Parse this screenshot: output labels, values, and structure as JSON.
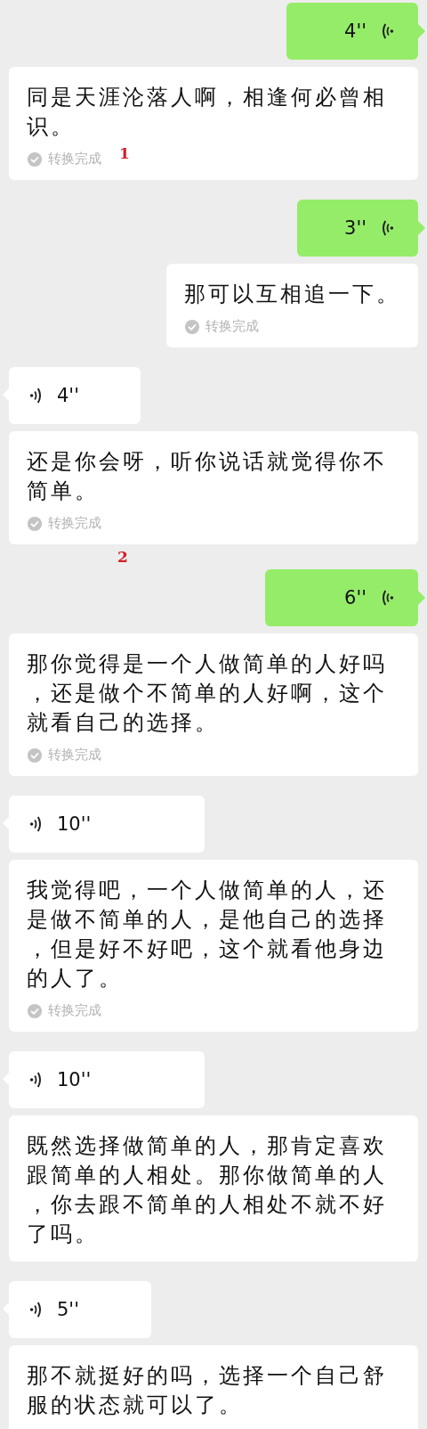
{
  "messages": [
    {
      "kind": "voice",
      "outgoing": true,
      "duration": "4''"
    },
    {
      "kind": "transcript",
      "outgoing": false,
      "lines": [
        "同是天涯沦落人啊，相逢何必曾相",
        "识。"
      ],
      "status": "转换完成",
      "marker": "1"
    },
    {
      "kind": "voice",
      "outgoing": true,
      "duration": "3''"
    },
    {
      "kind": "transcript",
      "outgoing": true,
      "lines": [
        "那可以互相追一下。"
      ],
      "status": "转换完成"
    },
    {
      "kind": "voice",
      "outgoing": false,
      "duration": "4''"
    },
    {
      "kind": "transcript",
      "outgoing": false,
      "lines": [
        "还是你会呀，听你说话就觉得你不",
        "简单。"
      ],
      "status": "转换完成"
    },
    {
      "kind": "marker",
      "text": "2"
    },
    {
      "kind": "voice",
      "outgoing": true,
      "duration": "6''"
    },
    {
      "kind": "transcript",
      "outgoing": false,
      "lines": [
        "那你觉得是一个人做简单的人好吗",
        "，还是做个不简单的人好啊，这个",
        "就看自己的选择。"
      ],
      "status": "转换完成"
    },
    {
      "kind": "voice",
      "outgoing": false,
      "duration": "10''"
    },
    {
      "kind": "transcript",
      "outgoing": false,
      "lines": [
        "我觉得吧，一个人做简单的人，还",
        "是做不简单的人，是他自己的选择",
        "，但是好不好吧，这个就看他身边",
        "的人了。"
      ],
      "status": "转换完成"
    },
    {
      "kind": "voice",
      "outgoing": false,
      "duration": "10''"
    },
    {
      "kind": "transcript",
      "outgoing": false,
      "lines": [
        "既然选择做简单的人，那肯定喜欢",
        "跟简单的人相处。那你做简单的人",
        "，你去跟不简单的人相处不就不好",
        "了吗。"
      ]
    },
    {
      "kind": "voice",
      "outgoing": false,
      "duration": "5''"
    },
    {
      "kind": "transcript",
      "outgoing": false,
      "lines": [
        "那不就挺好的吗，选择一个自己舒",
        "服的状态就可以了。"
      ]
    }
  ]
}
